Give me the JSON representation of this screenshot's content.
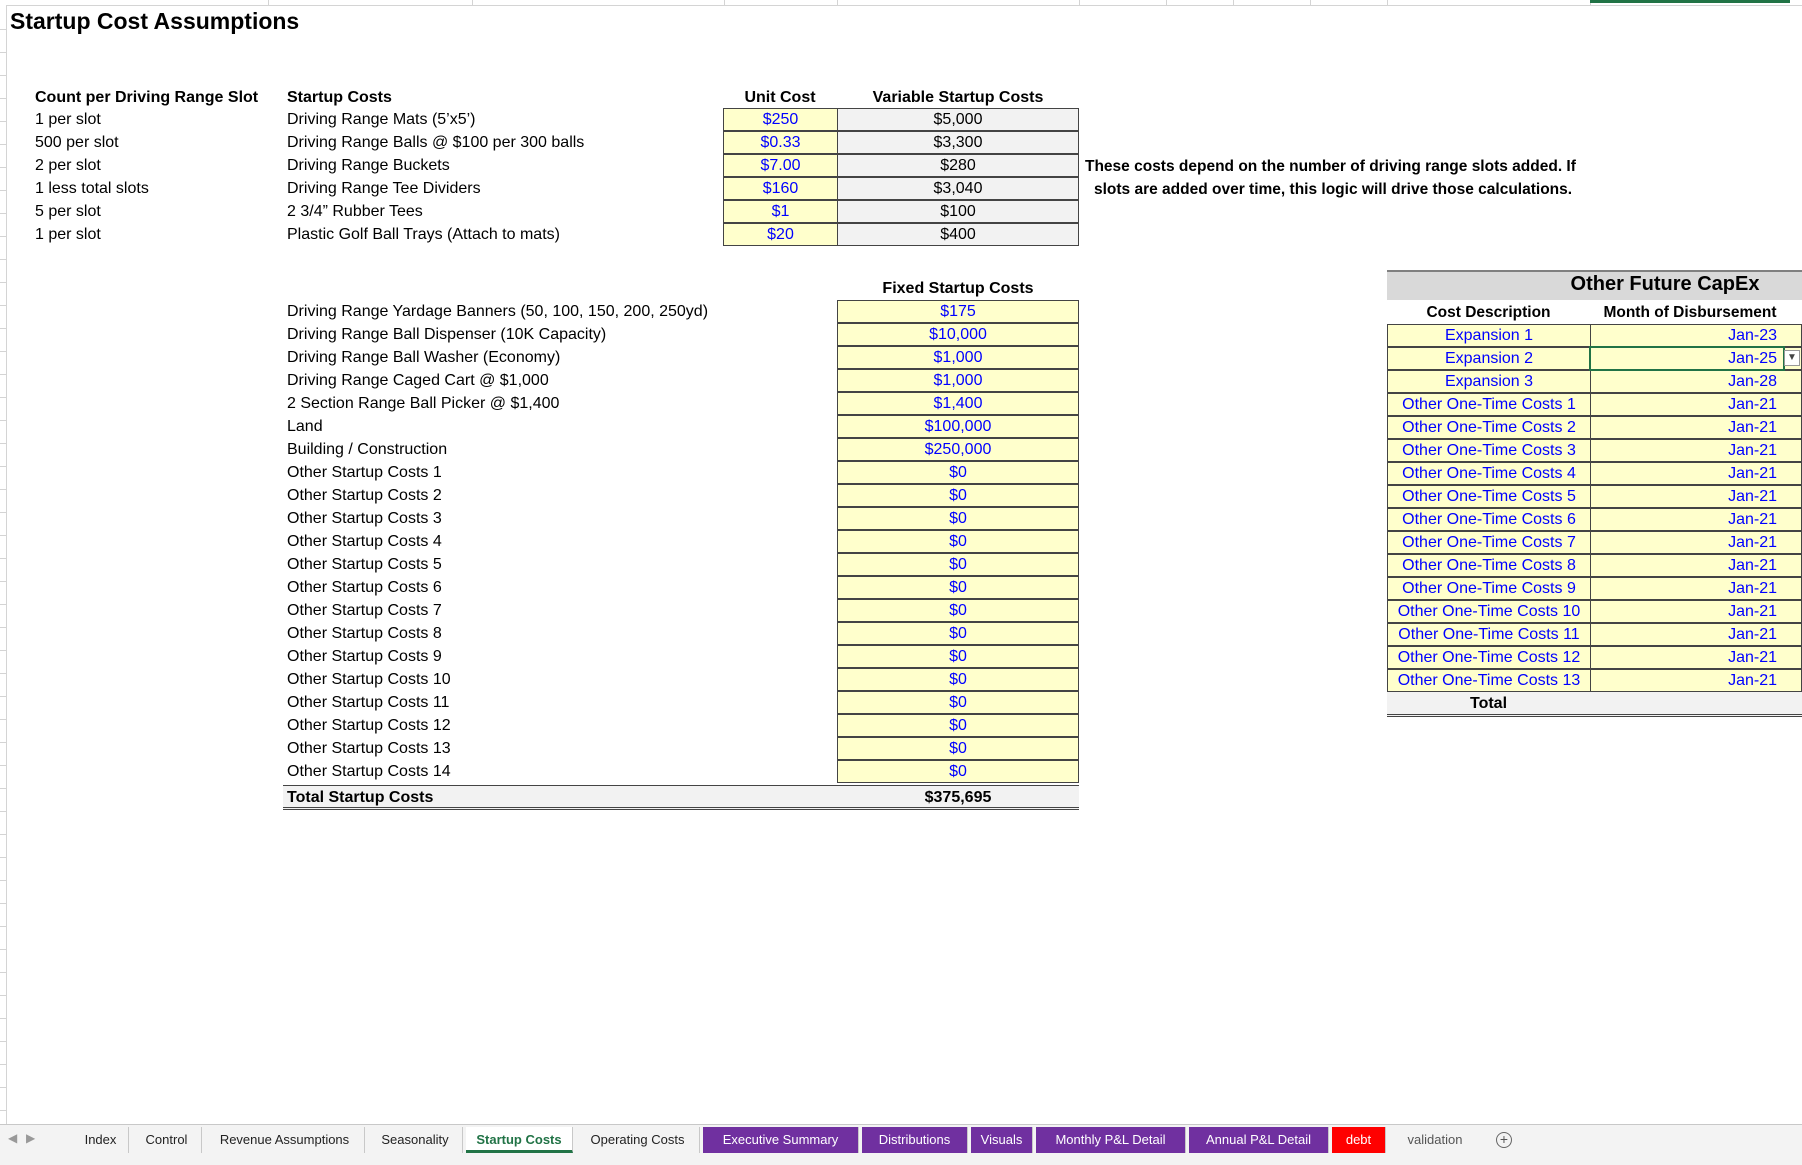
{
  "title": "Startup Cost Assumptions",
  "variable": {
    "count_header": "Count per Driving Range Slot",
    "costs_header": "Startup Costs",
    "unit_header": "Unit Cost",
    "var_header": "Variable Startup Costs",
    "rows": [
      {
        "count": "1 per slot",
        "desc": "Driving Range Mats (5’x5’)",
        "unit": "$250",
        "var": "$5,000"
      },
      {
        "count": "500 per slot",
        "desc": "Driving Range Balls @ $100 per 300 balls",
        "unit": "$0.33",
        "var": "$3,300"
      },
      {
        "count": "2 per slot",
        "desc": "Driving Range Buckets",
        "unit": "$7.00",
        "var": "$280"
      },
      {
        "count": "1 less total slots",
        "desc": "Driving Range Tee Dividers",
        "unit": "$160",
        "var": "$3,040"
      },
      {
        "count": "5 per slot",
        "desc": "2 3/4” Rubber Tees",
        "unit": "$1",
        "var": "$100"
      },
      {
        "count": "1 per slot",
        "desc": "Plastic Golf Ball Trays (Attach to mats)",
        "unit": "$20",
        "var": "$400"
      }
    ],
    "note_line1": "These costs depend on the number of driving range slots added. If",
    "note_line2": "slots are added over time, this logic will drive those calculations."
  },
  "fixed": {
    "header": "Fixed Startup Costs",
    "rows": [
      {
        "desc": "Driving Range Yardage Banners (50, 100, 150, 200, 250yd)",
        "val": "$175"
      },
      {
        "desc": "Driving Range Ball Dispenser (10K Capacity)",
        "val": "$10,000"
      },
      {
        "desc": "Driving Range Ball Washer (Economy)",
        "val": "$1,000"
      },
      {
        "desc": "Driving Range Caged Cart @ $1,000",
        "val": "$1,000"
      },
      {
        "desc": "2 Section Range Ball Picker @ $1,400",
        "val": "$1,400"
      },
      {
        "desc": "Land",
        "val": "$100,000"
      },
      {
        "desc": "Building / Construction",
        "val": "$250,000"
      },
      {
        "desc": "Other Startup Costs 1",
        "val": "$0"
      },
      {
        "desc": "Other Startup Costs 2",
        "val": "$0"
      },
      {
        "desc": "Other Startup Costs 3",
        "val": "$0"
      },
      {
        "desc": "Other Startup Costs 4",
        "val": "$0"
      },
      {
        "desc": "Other Startup Costs 5",
        "val": "$0"
      },
      {
        "desc": "Other Startup Costs 6",
        "val": "$0"
      },
      {
        "desc": "Other Startup Costs 7",
        "val": "$0"
      },
      {
        "desc": "Other Startup Costs 8",
        "val": "$0"
      },
      {
        "desc": "Other Startup Costs 9",
        "val": "$0"
      },
      {
        "desc": "Other Startup Costs 10",
        "val": "$0"
      },
      {
        "desc": "Other Startup Costs 11",
        "val": "$0"
      },
      {
        "desc": "Other Startup Costs 12",
        "val": "$0"
      },
      {
        "desc": "Other Startup Costs 13",
        "val": "$0"
      },
      {
        "desc": "Other Startup Costs 14",
        "val": "$0"
      }
    ],
    "total_label": "Total Startup Costs",
    "total_value": "$375,695"
  },
  "capex": {
    "title": "Other Future CapEx",
    "col1": "Cost Description",
    "col2": "Month of Disbursement",
    "rows": [
      {
        "desc": "Expansion 1",
        "month": "Jan-23"
      },
      {
        "desc": "Expansion 2",
        "month": "Jan-25"
      },
      {
        "desc": "Expansion 3",
        "month": "Jan-28"
      },
      {
        "desc": "Other One-Time Costs 1",
        "month": "Jan-21"
      },
      {
        "desc": "Other One-Time Costs 2",
        "month": "Jan-21"
      },
      {
        "desc": "Other One-Time Costs 3",
        "month": "Jan-21"
      },
      {
        "desc": "Other One-Time Costs 4",
        "month": "Jan-21"
      },
      {
        "desc": "Other One-Time Costs 5",
        "month": "Jan-21"
      },
      {
        "desc": "Other One-Time Costs 6",
        "month": "Jan-21"
      },
      {
        "desc": "Other One-Time Costs 7",
        "month": "Jan-21"
      },
      {
        "desc": "Other One-Time Costs 8",
        "month": "Jan-21"
      },
      {
        "desc": "Other One-Time Costs 9",
        "month": "Jan-21"
      },
      {
        "desc": "Other One-Time Costs 10",
        "month": "Jan-21"
      },
      {
        "desc": "Other One-Time Costs 11",
        "month": "Jan-21"
      },
      {
        "desc": "Other One-Time Costs 12",
        "month": "Jan-21"
      },
      {
        "desc": "Other One-Time Costs 13",
        "month": "Jan-21"
      }
    ],
    "total_label": "Total"
  },
  "tabs": [
    {
      "label": "Index",
      "style": "normal"
    },
    {
      "label": "Control",
      "style": "normal"
    },
    {
      "label": "Revenue Assumptions",
      "style": "normal"
    },
    {
      "label": "Seasonality",
      "style": "normal"
    },
    {
      "label": "Startup Costs",
      "style": "active"
    },
    {
      "label": "Operating Costs",
      "style": "normal"
    },
    {
      "label": "Executive Summary",
      "style": "purple"
    },
    {
      "label": "Distributions",
      "style": "purple"
    },
    {
      "label": "Visuals",
      "style": "purple"
    },
    {
      "label": "Monthly P&L Detail",
      "style": "purple"
    },
    {
      "label": "Annual P&L Detail",
      "style": "purple"
    },
    {
      "label": "debt",
      "style": "red"
    },
    {
      "label": "validation",
      "style": "plain"
    }
  ],
  "colors": {
    "input_fill": "#ffffcc",
    "input_text": "#0000ff",
    "calc_fill": "#f2f2f2",
    "tab_purple": "#7030a0",
    "tab_red": "#ff0000",
    "active_green": "#217346"
  },
  "icons": {
    "dropdown": "chevron-down-icon",
    "add_sheet": "plus-circle-icon",
    "nav_prev": "arrow-left-icon",
    "nav_next": "arrow-right-icon"
  }
}
